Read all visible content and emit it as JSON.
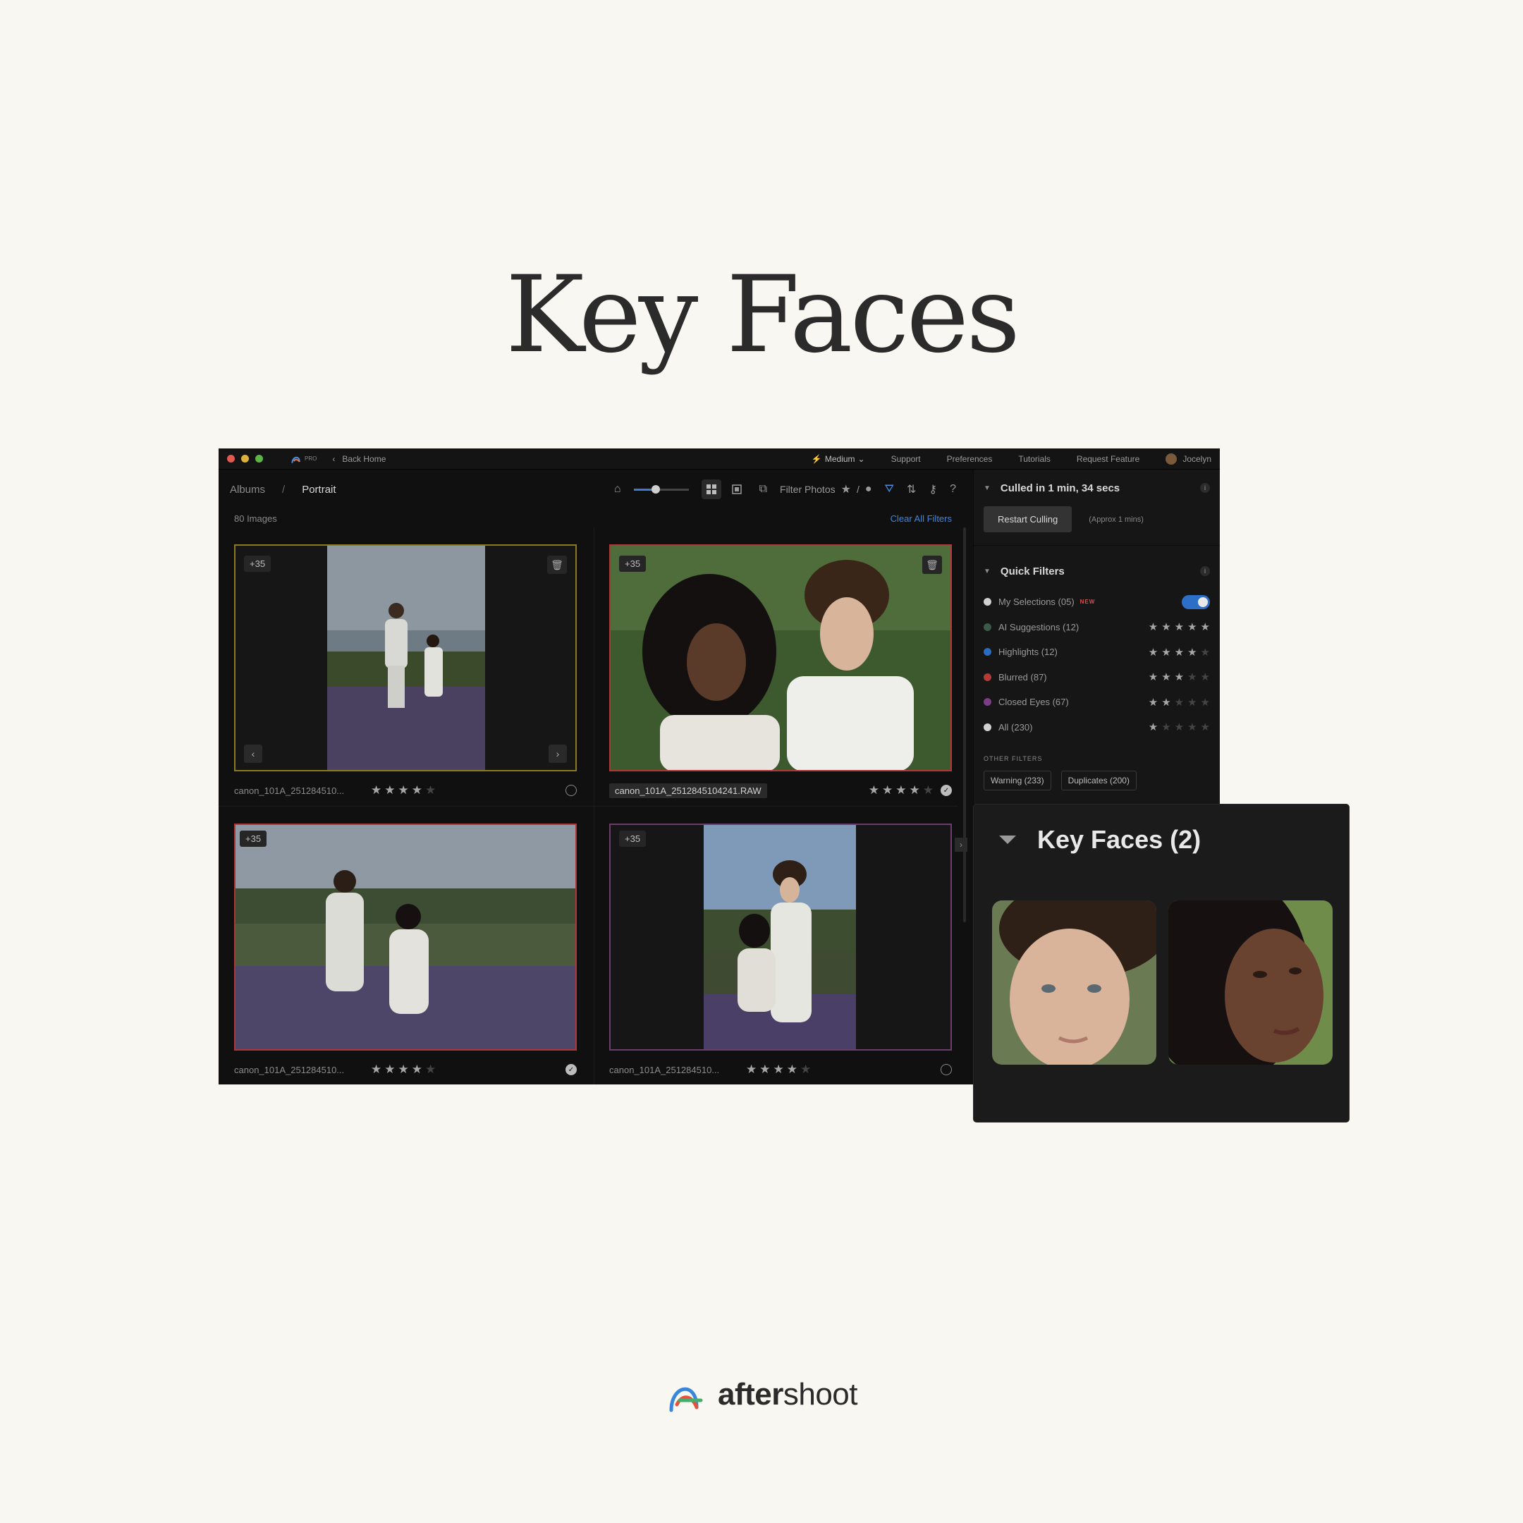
{
  "hero": {
    "title": "Key Faces"
  },
  "titlebar": {
    "pro_label": "PRO",
    "back_label": "Back Home",
    "profile": "Medium",
    "menu": [
      "Support",
      "Preferences",
      "Tutorials",
      "Request Feature"
    ],
    "user": "Jocelyn"
  },
  "toolbar": {
    "breadcrumb_root": "Albums",
    "breadcrumb_sep": "/",
    "breadcrumb_current": "Portrait",
    "zoom_level": 0.4,
    "filter_label": "Filter Photos",
    "filter_sep": "/"
  },
  "subbar": {
    "count": "80 Images",
    "clear_filters": "Clear All Filters"
  },
  "photos": [
    {
      "badge": "+35",
      "filename": "canon_101A_251284510...",
      "rating": 4,
      "selected": false,
      "frame_color": "#8b7a22"
    },
    {
      "badge": "+35",
      "filename": "canon_101A_2512845104241.RAW",
      "rating": 4,
      "selected": true,
      "frame_color": "#b0363a"
    },
    {
      "badge": "+35",
      "filename": "canon_101A_251284510...",
      "rating": 4,
      "selected": true,
      "frame_color": "#b0363a"
    },
    {
      "badge": "+35",
      "filename": "canon_101A_251284510...",
      "rating": 4,
      "selected": false,
      "frame_color": "#6a3d6e"
    }
  ],
  "panel": {
    "culled_title": "Culled in 1 min, 34 secs",
    "restart_label": "Restart Culling",
    "approx_label": "(Approx 1 mins)",
    "quick_filters_title": "Quick Filters",
    "new_tag": "NEW",
    "filters": [
      {
        "label": "My Selections (05)",
        "color": "#d0d0d0",
        "type": "toggle",
        "on": true
      },
      {
        "label": "AI Suggestions (12)",
        "color": "#3c5a4a",
        "stars": 5
      },
      {
        "label": "Highlights (12)",
        "color": "#2a6bc4",
        "stars": 4
      },
      {
        "label": "Blurred (87)",
        "color": "#b53a36",
        "stars": 3
      },
      {
        "label": "Closed Eyes (67)",
        "color": "#7a3d86",
        "stars": 2
      },
      {
        "label": "All (230)",
        "color": "#d0d0d0",
        "stars": 1
      }
    ],
    "other_filters_label": "OTHER FILTERS",
    "chips": [
      "Warning (233)",
      "Duplicates (200)"
    ]
  },
  "key_faces": {
    "title": "Key Faces (2)"
  },
  "brand": {
    "name_bold": "after",
    "name_light": "shoot"
  },
  "colors": {
    "accent": "#3a7bd5",
    "background": "#f9f7f2",
    "app_bg": "#101010"
  }
}
